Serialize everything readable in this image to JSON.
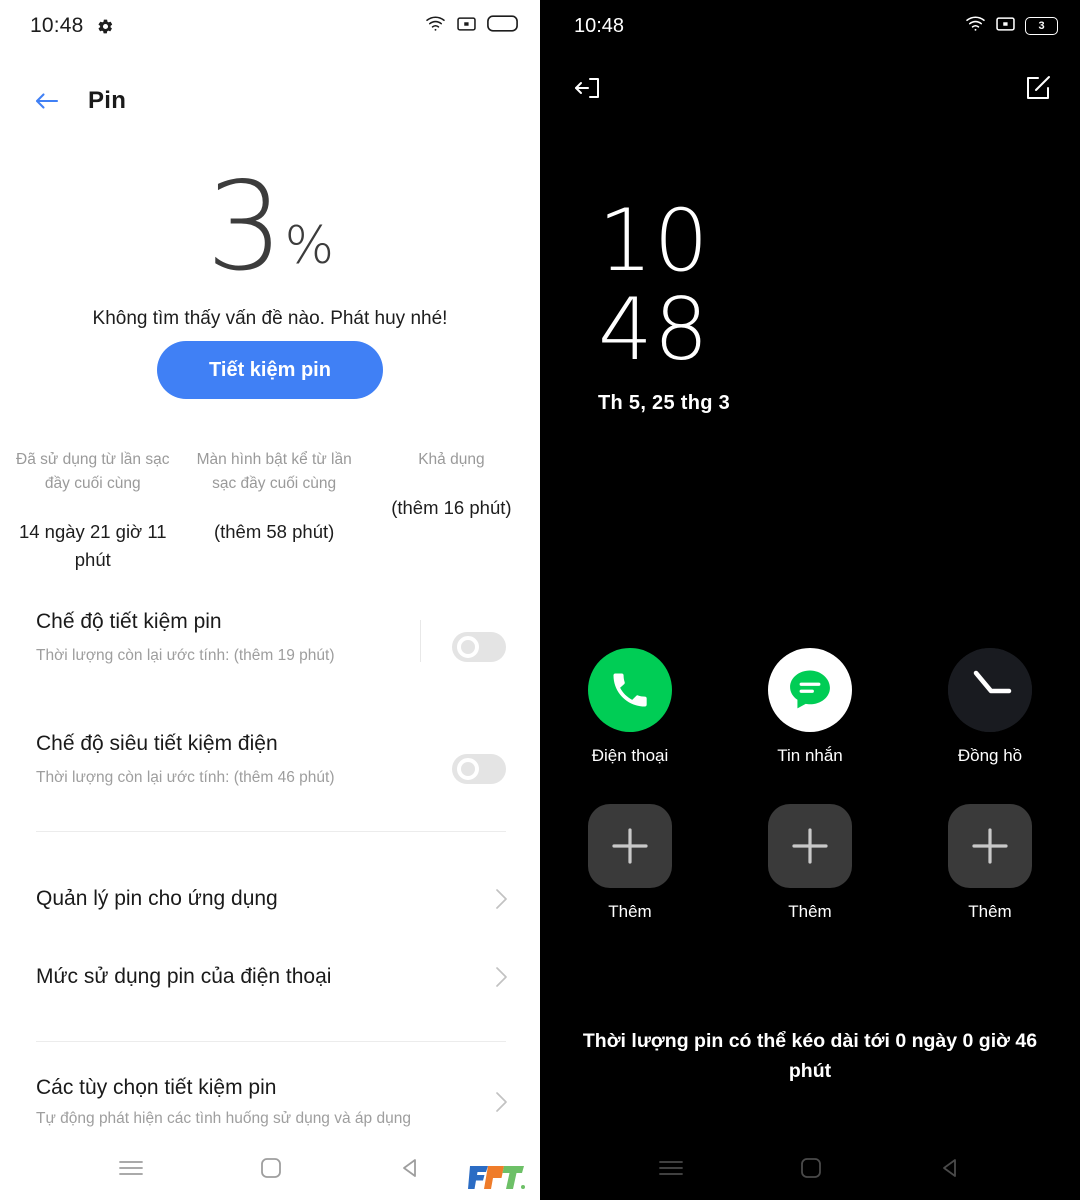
{
  "left": {
    "statusbar": {
      "time": "10:48",
      "icons": [
        "gear-icon",
        "wifi-icon",
        "screen-record-icon",
        "battery-icon"
      ]
    },
    "appbar": {
      "back_icon": "back-arrow-icon",
      "title": "Pin"
    },
    "battery": {
      "percent": "3",
      "percent_symbol": "%",
      "status_message": "Không tìm thấy vấn đề nào. Phát huy nhé!",
      "save_button": "Tiết kiệm pin"
    },
    "stats": [
      {
        "label": "Đã sử dụng từ lần sạc đầy cuối cùng",
        "value": "14 ngày 21 giờ 11 phút"
      },
      {
        "label": "Màn hình bật kể từ lần sạc đầy cuối cùng",
        "value": "(thêm 58 phút)"
      },
      {
        "label": "Khả dụng",
        "value": "(thêm 16 phút)"
      }
    ],
    "toggles": [
      {
        "title": "Chế độ tiết kiệm pin",
        "subtitle": "Thời lượng còn lại ước tính:  (thêm 19 phút)",
        "state": "off"
      },
      {
        "title": "Chế độ siêu tiết kiệm điện",
        "subtitle": "Thời lượng còn lại ước tính:  (thêm 46 phút)",
        "state": "off"
      }
    ],
    "nav_items": [
      {
        "title": "Quản lý pin cho ứng dụng",
        "subtitle": ""
      },
      {
        "title": "Mức sử dụng pin của điện thoại",
        "subtitle": ""
      },
      {
        "title": "Các tùy chọn tiết kiệm pin",
        "subtitle": "Tự động phát hiện các tình huống sử dụng và áp dụng"
      }
    ],
    "navbar": [
      "menu-icon",
      "home-icon",
      "back-icon"
    ],
    "watermark": "FPT"
  },
  "right": {
    "statusbar": {
      "time": "10:48",
      "battery_level": "3",
      "icons": [
        "wifi-icon",
        "screen-record-icon",
        "battery-icon"
      ]
    },
    "topbar": {
      "exit_icon": "exit-icon",
      "edit_icon": "edit-icon"
    },
    "clock": {
      "hours": "10",
      "minutes": "48",
      "date": "Th 5, 25 thg 3"
    },
    "apps": [
      {
        "label": "Điện thoại",
        "icon": "phone-icon"
      },
      {
        "label": "Tin nhắn",
        "icon": "message-icon"
      },
      {
        "label": "Đồng hồ",
        "icon": "clock-icon"
      },
      {
        "label": "Thêm",
        "icon": "plus-icon"
      },
      {
        "label": "Thêm",
        "icon": "plus-icon"
      },
      {
        "label": "Thêm",
        "icon": "plus-icon"
      }
    ],
    "battery_note": "Thời lượng pin có thể kéo dài tới 0 ngày 0 giờ 46 phút",
    "navbar": [
      "menu-icon",
      "home-icon",
      "back-icon"
    ]
  },
  "colors": {
    "accent_blue": "#4080f5",
    "phone_green": "#00cd55",
    "dark_bg": "#000000",
    "light_bg": "#ffffff"
  }
}
